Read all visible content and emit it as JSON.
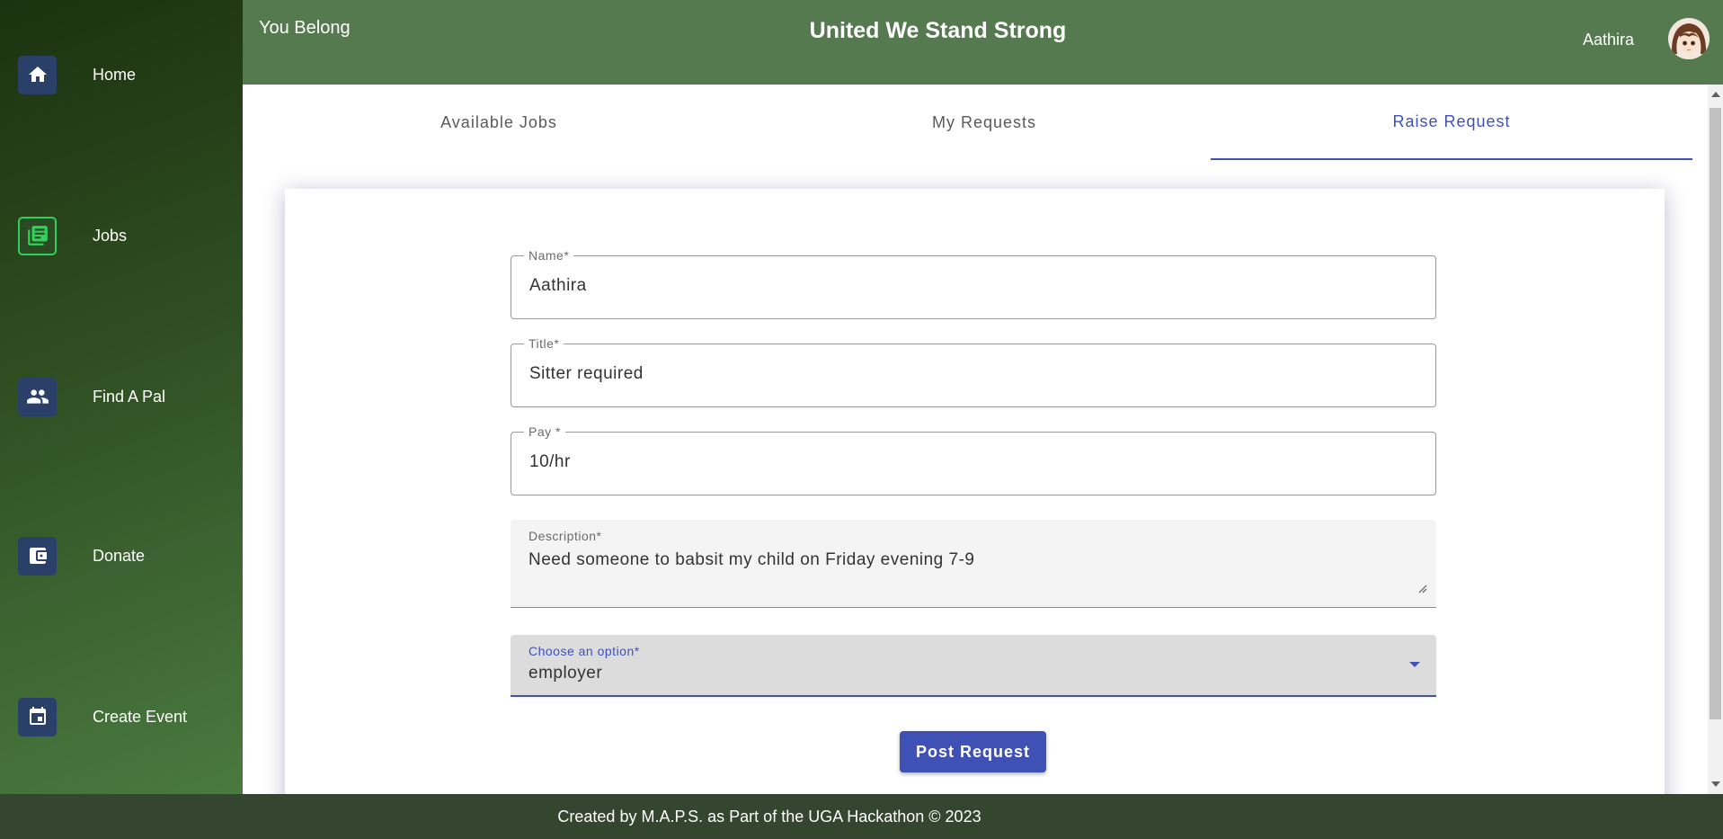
{
  "sidebar": {
    "items": [
      {
        "label": "Home",
        "icon": "home-icon"
      },
      {
        "label": "Jobs",
        "icon": "jobs-icon"
      },
      {
        "label": "Find A Pal",
        "icon": "people-icon"
      },
      {
        "label": "Donate",
        "icon": "wallet-icon"
      },
      {
        "label": "Create Event",
        "icon": "calendar-icon"
      }
    ],
    "active": "Jobs"
  },
  "header": {
    "tagline": "You Belong",
    "title": "United We Stand Strong",
    "username": "Aathira"
  },
  "tabs": [
    {
      "label": "Available Jobs"
    },
    {
      "label": "My Requests"
    },
    {
      "label": "Raise Request"
    }
  ],
  "active_tab": "Raise Request",
  "form": {
    "name": {
      "label": "Name*",
      "value": "Aathira"
    },
    "title": {
      "label": "Title*",
      "value": "Sitter required"
    },
    "pay": {
      "label": "Pay *",
      "value": "10/hr"
    },
    "description": {
      "label": "Description*",
      "value": "Need someone to babsit my child on Friday evening 7-9"
    },
    "option": {
      "label": "Choose an option*",
      "value": "employer"
    },
    "submit_label": "Post Request"
  },
  "footer": {
    "text": "Created by M.A.P.S. as Part of the UGA Hackathon © 2023"
  },
  "colors": {
    "primary": "#3f51b5",
    "header_bg": "#567a50",
    "sidebar_dark": "#1c3210",
    "footer_bg": "#34462f",
    "nav_icon_bg": "#2b4068",
    "active_icon_border": "#32d05a"
  }
}
